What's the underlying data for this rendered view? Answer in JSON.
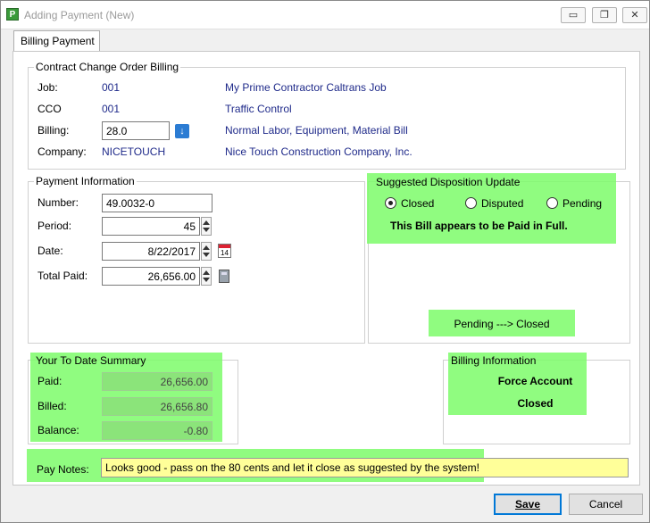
{
  "window": {
    "title": "Adding Payment  (New)",
    "app_icon": "P",
    "controls": [
      "▭",
      "❐",
      "✕"
    ]
  },
  "tabs": [
    {
      "label": "Billing Payment"
    }
  ],
  "contract": {
    "title": "Contract Change Order Billing",
    "job_label": "Job:",
    "job_code": "001",
    "job_desc": "My Prime Contractor Caltrans Job",
    "cco_label": "CCO",
    "cco_code": "001",
    "cco_desc": "Traffic Control",
    "billing_label": "Billing:",
    "billing_value": "28.0",
    "billing_desc": "Normal Labor, Equipment, Material Bill",
    "company_label": "Company:",
    "company_code": "NICETOUCH",
    "company_desc": "Nice Touch Construction Company, Inc."
  },
  "payment": {
    "title": "Payment Information",
    "number_label": "Number:",
    "number_value": "49.0032-0",
    "period_label": "Period:",
    "period_value": "45",
    "date_label": "Date:",
    "date_value": "8/22/2017",
    "total_label": "Total Paid:",
    "total_value": "26,656.00"
  },
  "disposition": {
    "title": "Suggested Disposition Update",
    "options": [
      "Closed",
      "Disputed",
      "Pending"
    ],
    "selected": "Closed",
    "message": "This Bill appears to be Paid in Full.",
    "transition": "Pending ---> Closed"
  },
  "summary": {
    "title": "Your To Date Summary",
    "paid_label": "Paid:",
    "paid_value": "26,656.00",
    "billed_label": "Billed:",
    "billed_value": "26,656.80",
    "balance_label": "Balance:",
    "balance_value": "-0.80"
  },
  "billing_info": {
    "title": "Billing Information",
    "type": "Force Account",
    "status": "Closed"
  },
  "notes": {
    "label": "Pay Notes:",
    "value": "Looks good - pass on the 80 cents and let it close as suggested by the system!"
  },
  "buttons": {
    "save": "Save",
    "cancel": "Cancel"
  },
  "colors": {
    "highlight": "#7cfc6a",
    "link_text": "#1f2a8a",
    "notes_bg": "#ffff99"
  }
}
